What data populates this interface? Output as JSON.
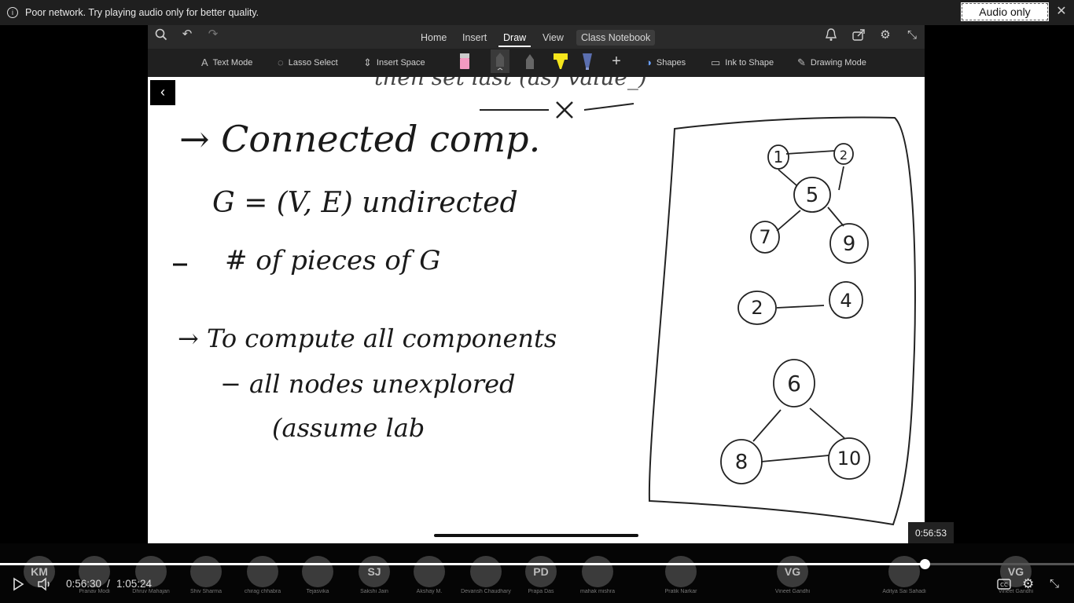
{
  "banner": {
    "message": "Poor network. Try playing audio only for better quality.",
    "audio_only_label": "Audio only",
    "info_icon": "i",
    "close_icon": "✕"
  },
  "ribbon": {
    "tabs": [
      "Home",
      "Insert",
      "Draw",
      "View",
      "Class Notebook"
    ],
    "active_tab": "Draw",
    "tools": {
      "text_mode": "Text Mode",
      "lasso_select": "Lasso Select",
      "insert_space": "Insert Space",
      "shapes": "Shapes",
      "ink_to_shape": "Ink to Shape",
      "drawing_mode": "Drawing Mode"
    },
    "pen_colors": [
      "#f49ac1",
      "#555555",
      "#666666",
      "#f5e51b",
      "#5b6fb0"
    ]
  },
  "notes": {
    "top_partial": "then set last (as) value_)",
    "heading": "→ Connected comp.",
    "line1": "G = (V, E)   undirected",
    "line2": "# of pieces  of  G",
    "line3": "→  To compute all  components",
    "line4": "− all  nodes  unexplored",
    "line5": "(assume  lab",
    "graph_nodes": [
      "1",
      "2",
      "5",
      "7",
      "9",
      "2",
      "4",
      "6",
      "8",
      "10"
    ]
  },
  "player": {
    "current_time": "0:56:30",
    "separator": "/",
    "total_time": "1:05:24",
    "hover_time": "0:56:53",
    "progress": 0.861
  },
  "participants": [
    {
      "initials": "KM",
      "name": ""
    },
    {
      "initials": "",
      "name": "Pranav Modi"
    },
    {
      "initials": "",
      "name": "Dhruv Mahajan"
    },
    {
      "initials": "",
      "name": "Shiv Sharma"
    },
    {
      "initials": "",
      "name": "chirag chhabra"
    },
    {
      "initials": "",
      "name": "Tejasvika"
    },
    {
      "initials": "SJ",
      "name": "Sakshi Jain"
    },
    {
      "initials": "",
      "name": "Akshay M."
    },
    {
      "initials": "",
      "name": "Devansh Chaudhary"
    },
    {
      "initials": "PD",
      "name": "Prapa Das"
    },
    {
      "initials": "",
      "name": "mahak mishra"
    },
    {
      "initials": "",
      "name": "Pratik Narkar"
    },
    {
      "initials": "VG",
      "name": "Vineet Gandhi"
    },
    {
      "initials": "",
      "name": "Aditya Sai Sahadi"
    },
    {
      "initials": "VG",
      "name": "Vineet Gandhi"
    }
  ]
}
